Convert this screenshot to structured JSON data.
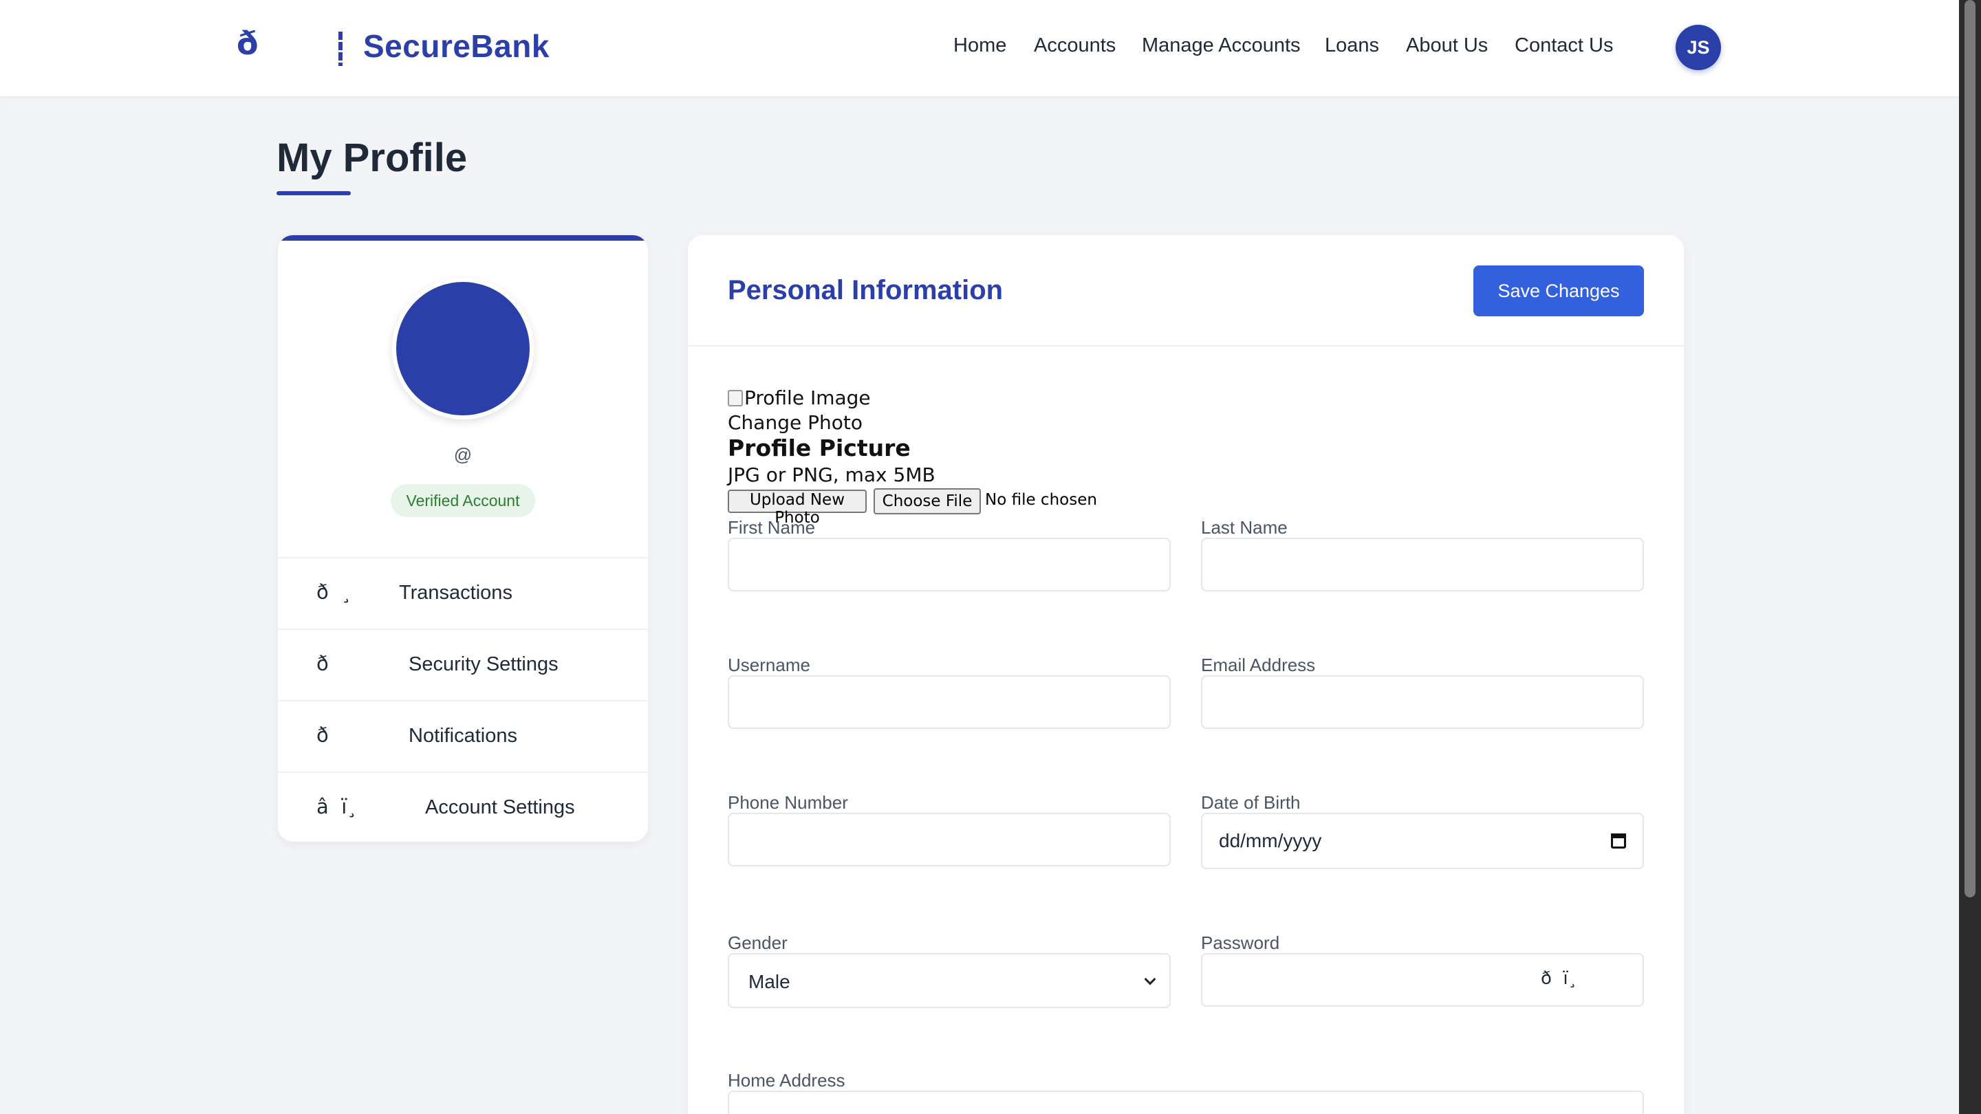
{
  "brand": {
    "glyph": "ð",
    "name": "SecureBank"
  },
  "nav": {
    "links": [
      "Home",
      "Accounts",
      "Manage Accounts",
      "Loans",
      "About Us",
      "Contact Us"
    ],
    "avatar_initials": "JS"
  },
  "page": {
    "title": "My Profile"
  },
  "profile_card": {
    "handle": "@",
    "verified_label": "Verified Account",
    "menu": [
      {
        "icon": "ð  ¸",
        "label": "Transactions"
      },
      {
        "icon": "ð",
        "label": "Security Settings"
      },
      {
        "icon": "ð",
        "label": "Notifications"
      },
      {
        "icon": "â  ï¸",
        "label": "Account Settings"
      }
    ]
  },
  "personal_info": {
    "title": "Personal Information",
    "save_label": "Save Changes",
    "profile_image_alt": "Profile Image",
    "change_photo": "Change Photo",
    "picture_heading": "Profile Picture",
    "file_hint": "JPG or PNG, max 5MB",
    "upload_label": "Upload New Photo",
    "choose_file_label": "Choose File",
    "no_file_label": "No file chosen",
    "fields": {
      "first_name": {
        "label": "First Name",
        "value": ""
      },
      "last_name": {
        "label": "Last Name",
        "value": ""
      },
      "username": {
        "label": "Username",
        "value": ""
      },
      "email": {
        "label": "Email Address",
        "value": ""
      },
      "phone": {
        "label": "Phone Number",
        "value": ""
      },
      "dob": {
        "label": "Date of Birth",
        "placeholder": "dd/mm/yyyy"
      },
      "gender": {
        "label": "Gender",
        "value": "Male"
      },
      "password": {
        "label": "Password",
        "toggle_icon": "ð  ï¸"
      },
      "address": {
        "label": "Home Address",
        "value": ""
      }
    }
  },
  "colors": {
    "brand_blue": "#2c3fa8",
    "button_blue": "#3360dd",
    "page_bg": "#f3f4f7",
    "verified_bg": "#e7f4e9",
    "verified_text": "#2e7d32"
  }
}
